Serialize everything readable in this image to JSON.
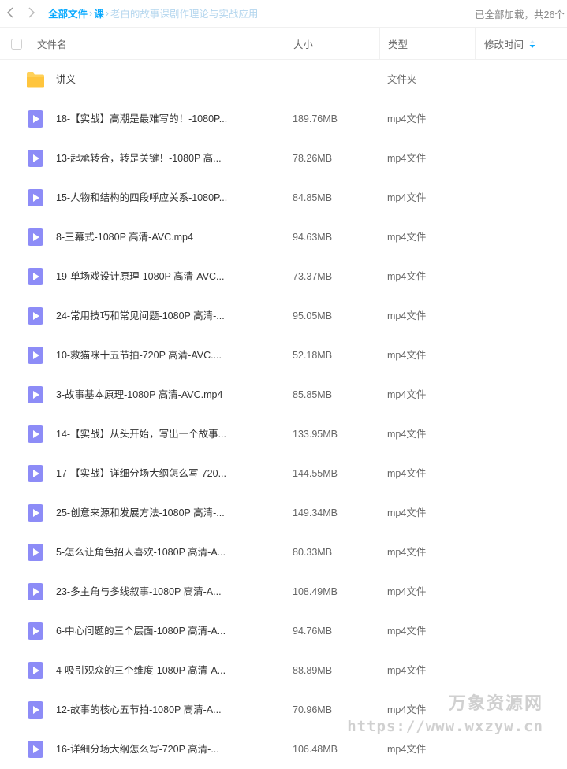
{
  "nav": {
    "back_icon": "chevron-left-icon",
    "forward_icon": "chevron-right-icon"
  },
  "breadcrumb": {
    "root": "全部文件",
    "sep1": "›",
    "level1": "课",
    "sep2": "›",
    "current": "老白的故事课剧作理论与实战应用"
  },
  "status": {
    "loaded_text": "已全部加载，共26个"
  },
  "table": {
    "headers": {
      "name": "文件名",
      "size": "大小",
      "type": "类型",
      "mtime": "修改时间"
    },
    "rows": [
      {
        "name": "讲义",
        "size": "-",
        "type": "文件夹",
        "icon": "folder-icon"
      },
      {
        "name": "18-【实战】高潮是最难写的！-1080P...",
        "size": "189.76MB",
        "type": "mp4文件",
        "icon": "video-file-icon"
      },
      {
        "name": "13-起承转合，转是关键！-1080P 高...",
        "size": "78.26MB",
        "type": "mp4文件",
        "icon": "video-file-icon"
      },
      {
        "name": "15-人物和结构的四段呼应关系-1080P...",
        "size": "84.85MB",
        "type": "mp4文件",
        "icon": "video-file-icon"
      },
      {
        "name": "8-三幕式-1080P 高清-AVC.mp4",
        "size": "94.63MB",
        "type": "mp4文件",
        "icon": "video-file-icon"
      },
      {
        "name": "19-单场戏设计原理-1080P 高清-AVC...",
        "size": "73.37MB",
        "type": "mp4文件",
        "icon": "video-file-icon"
      },
      {
        "name": "24-常用技巧和常见问题-1080P 高清-...",
        "size": "95.05MB",
        "type": "mp4文件",
        "icon": "video-file-icon"
      },
      {
        "name": "10-救猫咪十五节拍-720P 高清-AVC....",
        "size": "52.18MB",
        "type": "mp4文件",
        "icon": "video-file-icon"
      },
      {
        "name": "3-故事基本原理-1080P 高清-AVC.mp4",
        "size": "85.85MB",
        "type": "mp4文件",
        "icon": "video-file-icon"
      },
      {
        "name": "14-【实战】从头开始，写出一个故事...",
        "size": "133.95MB",
        "type": "mp4文件",
        "icon": "video-file-icon"
      },
      {
        "name": "17-【实战】详细分场大纲怎么写-720...",
        "size": "144.55MB",
        "type": "mp4文件",
        "icon": "video-file-icon"
      },
      {
        "name": "25-创意来源和发展方法-1080P 高清-...",
        "size": "149.34MB",
        "type": "mp4文件",
        "icon": "video-file-icon"
      },
      {
        "name": "5-怎么让角色招人喜欢-1080P 高清-A...",
        "size": "80.33MB",
        "type": "mp4文件",
        "icon": "video-file-icon"
      },
      {
        "name": "23-多主角与多线叙事-1080P 高清-A...",
        "size": "108.49MB",
        "type": "mp4文件",
        "icon": "video-file-icon"
      },
      {
        "name": "6-中心问题的三个层面-1080P 高清-A...",
        "size": "94.76MB",
        "type": "mp4文件",
        "icon": "video-file-icon"
      },
      {
        "name": "4-吸引观众的三个维度-1080P 高清-A...",
        "size": "88.89MB",
        "type": "mp4文件",
        "icon": "video-file-icon"
      },
      {
        "name": "12-故事的核心五节拍-1080P 高清-A...",
        "size": "70.96MB",
        "type": "mp4文件",
        "icon": "video-file-icon"
      },
      {
        "name": "16-详细分场大纲怎么写-720P 高清-...",
        "size": "106.48MB",
        "type": "mp4文件",
        "icon": "video-file-icon"
      }
    ]
  },
  "watermark": {
    "cn": "万象资源网",
    "url": "https://www.wxzyw.cn"
  },
  "colors": {
    "link": "#09aaff",
    "video_icon": "#8d8cf7",
    "folder_icon": "#ffc53d"
  }
}
